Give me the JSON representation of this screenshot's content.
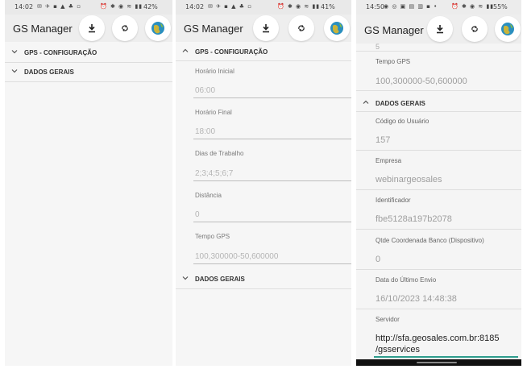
{
  "app": {
    "title": "GS Manager"
  },
  "screens": [
    {
      "status": {
        "time": "14:02",
        "battery": "42%"
      },
      "sections": [
        {
          "label": "GPS - CONFIGURAÇÃO",
          "expanded": false
        },
        {
          "label": "DADOS GERAIS",
          "expanded": false
        }
      ]
    },
    {
      "status": {
        "time": "14:02",
        "battery": "41%"
      },
      "gps_section": "GPS - CONFIGURAÇÃO",
      "fields": [
        {
          "label": "Horário Inicial",
          "value": "06:00"
        },
        {
          "label": "Horário Final",
          "value": "18:00"
        },
        {
          "label": "Dias de Trabalho",
          "value": "2;3;4;5;6;7"
        },
        {
          "label": "Distância",
          "value": "0"
        },
        {
          "label": "Tempo GPS",
          "value": "100,300000-50,600000"
        }
      ],
      "dados_section": "DADOS GERAIS"
    },
    {
      "status": {
        "time": "14:50",
        "battery": "55%"
      },
      "partial_value": "5",
      "tempo_gps": {
        "label": "Tempo GPS",
        "value": "100,300000-50,600000"
      },
      "dados_section": "DADOS GERAIS",
      "fields": [
        {
          "label": "Código do Usuário",
          "value": "157"
        },
        {
          "label": "Empresa",
          "value": "webinargeosales"
        },
        {
          "label": "Identificador",
          "value": "fbe5128a197b2078"
        },
        {
          "label": "Qtde Coordenada Banco (Dispositivo)",
          "value": "0"
        },
        {
          "label": "Data do Último Envio",
          "value": "16/10/2023 14:48:38"
        }
      ],
      "servidor": {
        "label": "Servidor",
        "line1": "http://sfa.geosales.com.br:8185",
        "line2": "/gsservices"
      }
    }
  ],
  "icons": {
    "download": "download-icon",
    "sync": "sync-icon",
    "globe": "globe-icon"
  },
  "colors": {
    "accent": "#2e9c8c",
    "globe_sea": "#2a8fbf",
    "globe_land": "#c9b43a"
  }
}
